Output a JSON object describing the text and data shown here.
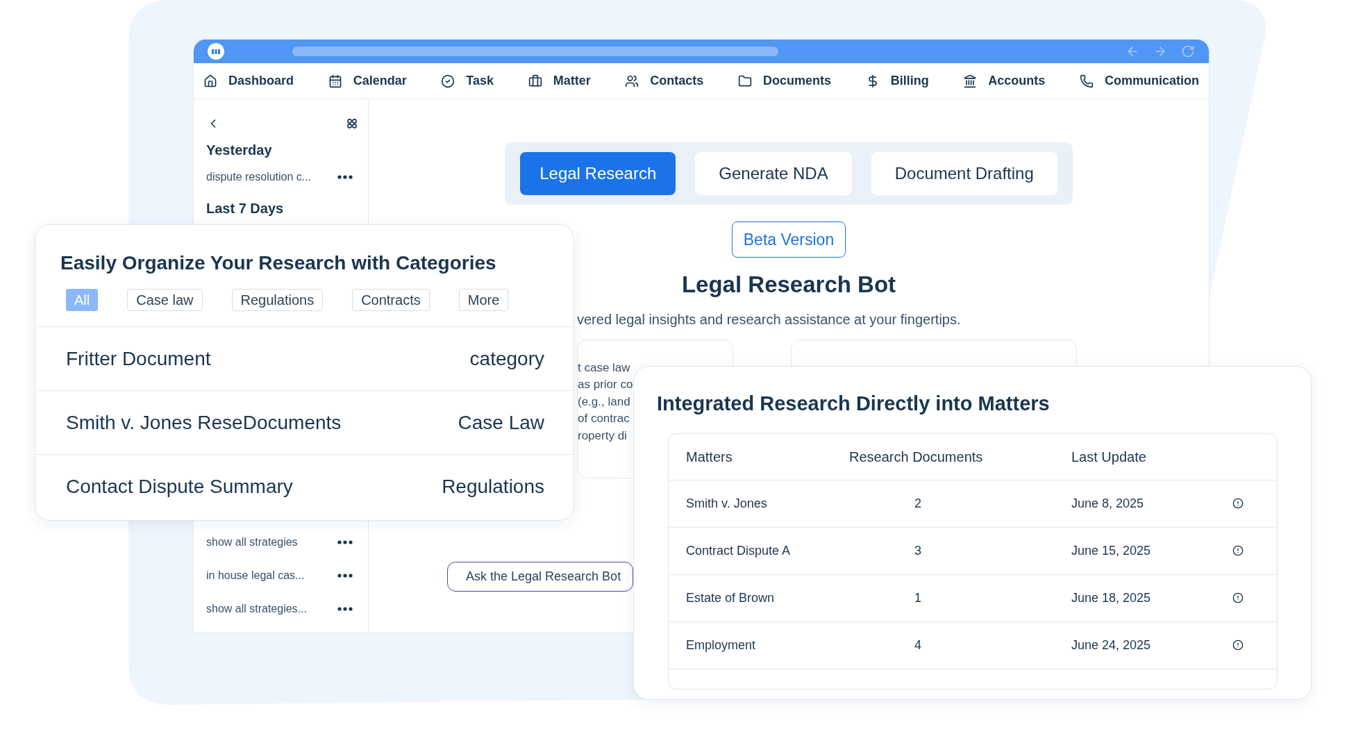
{
  "nav": [
    {
      "label": "Dashboard"
    },
    {
      "label": "Calendar"
    },
    {
      "label": "Task"
    },
    {
      "label": "Matter"
    },
    {
      "label": "Contacts"
    },
    {
      "label": "Documents"
    },
    {
      "label": "Billing"
    },
    {
      "label": "Accounts"
    },
    {
      "label": "Communication"
    }
  ],
  "sidebar": {
    "sections": [
      {
        "heading": "Yesterday",
        "items": [
          "dispute resolution c..."
        ]
      },
      {
        "heading": "Last 7 Days"
      }
    ],
    "lower_items": [
      "show all strategies",
      "in house legal cas...",
      "show all strategies..."
    ]
  },
  "mode_tabs": [
    {
      "label": "Legal Research",
      "selected": true
    },
    {
      "label": "Generate NDA",
      "selected": false
    },
    {
      "label": "Document Drafting",
      "selected": false
    }
  ],
  "badge": "Beta Version",
  "bot": {
    "title": "Legal Research Bot",
    "subtitle": "vered legal insights and research assistance at your fingertips.",
    "snippet_lines": [
      "t case law",
      "as prior co",
      "(e.g., land",
      "of contrac",
      "roperty di"
    ],
    "ask_button": "Ask the Legal Research Bot"
  },
  "categories_card": {
    "title": "Easily Organize Your Research with Categories",
    "filters": [
      {
        "label": "All",
        "selected": true
      },
      {
        "label": "Case law",
        "selected": false
      },
      {
        "label": "Regulations",
        "selected": false
      },
      {
        "label": "Contracts",
        "selected": false
      },
      {
        "label": "More",
        "selected": false
      }
    ],
    "rows": [
      {
        "name": "Fritter Document",
        "category": "category"
      },
      {
        "name": "Smith v. Jones ReseDocuments",
        "category": "Case Law"
      },
      {
        "name": "Contact Dispute Summary",
        "category": "Regulations"
      }
    ]
  },
  "matters_card": {
    "title": "Integrated Research Directly into Matters",
    "columns": [
      "Matters",
      "Research Documents",
      "Last Update"
    ],
    "rows": [
      {
        "matter": "Smith v. Jones",
        "documents": "2",
        "updated": "June 8, 2025"
      },
      {
        "matter": "Contract Dispute A",
        "documents": "3",
        "updated": "June 15, 2025"
      },
      {
        "matter": "Estate of Brown",
        "documents": "1",
        "updated": "June 18, 2025"
      },
      {
        "matter": "Employment",
        "documents": "4",
        "updated": "June 24, 2025"
      }
    ]
  }
}
